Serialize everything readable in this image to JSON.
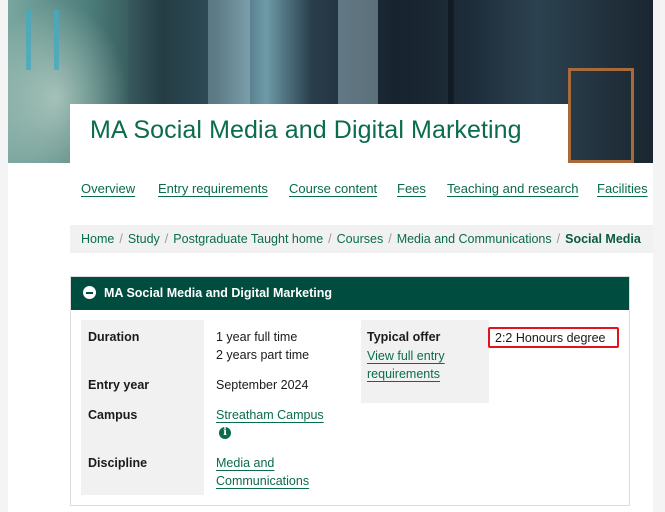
{
  "course": {
    "title": "MA Social Media and Digital Marketing"
  },
  "tabs": [
    "Overview",
    "Entry requirements",
    "Course content",
    "Fees",
    "Teaching and research",
    "Facilities"
  ],
  "breadcrumb": {
    "items": [
      "Home",
      "Study",
      "Postgraduate Taught home",
      "Courses",
      "Media and Communications"
    ],
    "current": "Social Media",
    "separator": "/"
  },
  "panel": {
    "heading": "MA Social Media and Digital Marketing",
    "duration_label": "Duration",
    "duration_lines": [
      "1 year full time",
      "2 years part time"
    ],
    "entry_year_label": "Entry year",
    "entry_year": "September 2024",
    "campus_label": "Campus",
    "campus": "Streatham Campus",
    "discipline_label": "Discipline",
    "discipline_lines": [
      "Media and",
      "Communications"
    ],
    "typical_offer_label": "Typical offer",
    "entry_link_lines": [
      "View full entry",
      "requirements"
    ],
    "typical_offer": "2:2 Honours degree"
  },
  "colors": {
    "brand_green": "#0a6b4e",
    "panel_header": "#004d40",
    "highlight_border": "#e0141b"
  },
  "icons": {
    "panel_toggle": "minus-circle-icon",
    "campus_info": "info-icon"
  }
}
